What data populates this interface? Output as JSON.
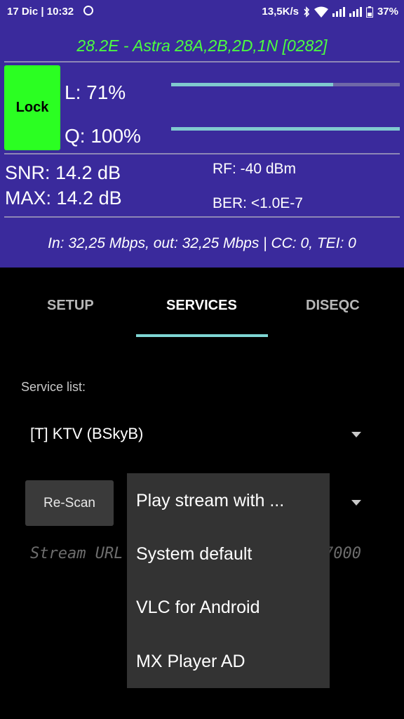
{
  "status": {
    "date_time": "17 Dic | 10:32",
    "net_speed": "13,5K/s",
    "battery": "37%"
  },
  "header": {
    "satellite": "28.2E - Astra 28A,2B,2D,1N [0282]",
    "lock_label": "Lock",
    "level_label": "L: 71%",
    "level_value": 0.71,
    "quality_label": "Q: 100%",
    "quality_value": 1.0,
    "snr": "SNR: 14.2 dB",
    "max": "MAX: 14.2 dB",
    "rf": "RF: -40 dBm",
    "ber": "BER: <1.0E-7",
    "rates": "In: 32,25 Mbps, out: 32,25 Mbps | CC: 0, TEI: 0"
  },
  "tabs": [
    {
      "label": "SETUP"
    },
    {
      "label": "SERVICES"
    },
    {
      "label": "DISEQC"
    }
  ],
  "active_tab": "SERVICES",
  "services": {
    "list_label": "Service list:",
    "selected_service": "[T] KTV (BSkyB)",
    "rescan_label": "Re-Scan",
    "stream_url_placeholder_start": "Stream URL",
    "stream_url_placeholder_end": "7000"
  },
  "popup": {
    "items": [
      "Play stream with ...",
      "System default",
      "VLC for Android",
      "MX Player AD"
    ]
  },
  "colors": {
    "header_bg": "#3a2a9c",
    "lock_green": "#2bff22",
    "title_green": "#4cff3f",
    "accent_teal": "#7fd6d3"
  }
}
